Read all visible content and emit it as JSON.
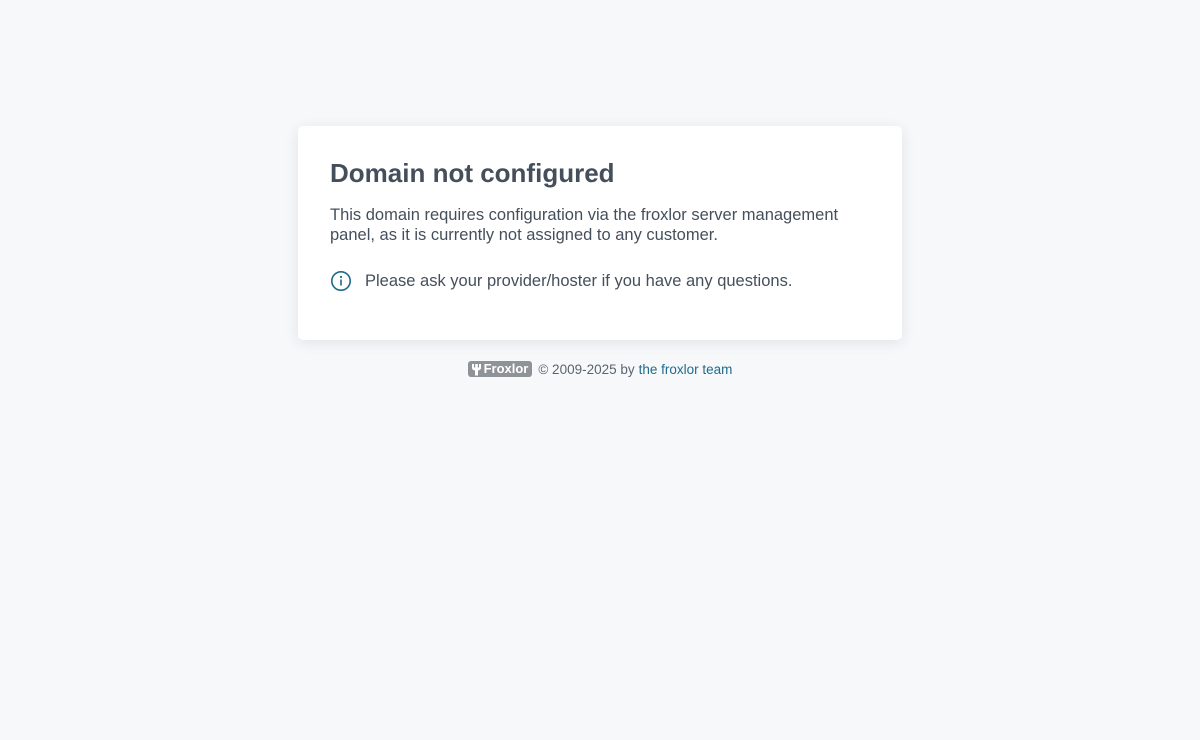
{
  "card": {
    "title": "Domain not configured",
    "description": "This domain requires configuration via the froxlor server management panel, as it is currently not assigned to any customer.",
    "info_icon": "info-circle-icon",
    "info_text": "Please ask your provider/hoster if you have any questions."
  },
  "footer": {
    "logo_text": "Froxlor",
    "copyright": "© 2009-2025 by",
    "link_text": "the froxlor team"
  },
  "colors": {
    "background": "#f7f8fa",
    "text": "#454f5b",
    "accent": "#1e6b8a",
    "logo_bg": "#8e9398"
  }
}
